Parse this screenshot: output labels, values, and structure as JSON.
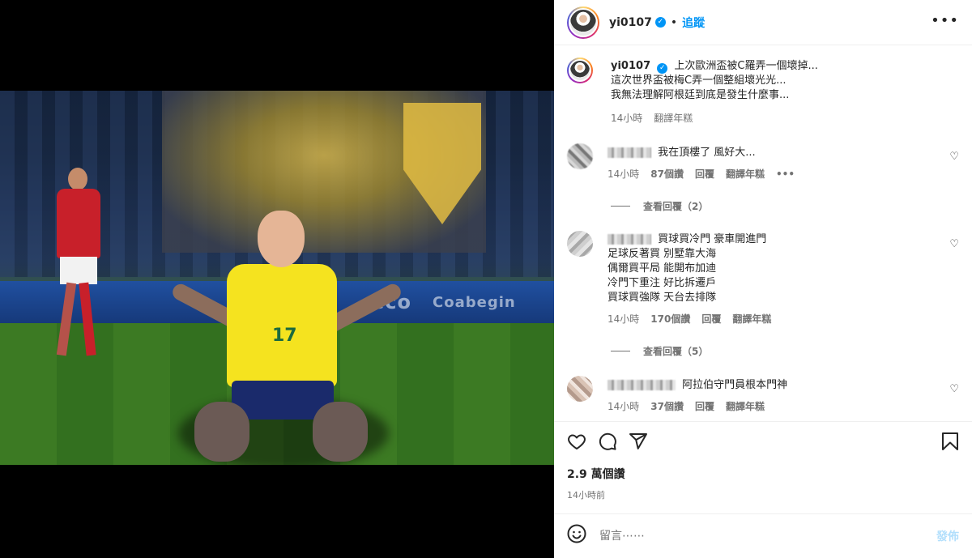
{
  "post": {
    "username": "yi0107",
    "verified_icon": "✓",
    "dot": "•",
    "follow_label": "追蹤",
    "more_icon": "•••"
  },
  "caption": {
    "username": "yi0107",
    "lines": [
      "上次歐洲盃被C羅弄一個壞掉...",
      "這次世界盃被梅C弄一個整組壞光光...",
      "我無法理解阿根廷到底是發生什麼事..."
    ],
    "time": "14小時",
    "translate": "翻譯年糕"
  },
  "comments": [
    {
      "text": "我在頂樓了 風好大...",
      "time": "14小時",
      "likes": "87個讚",
      "reply": "回覆",
      "translate": "翻譯年糕",
      "more": "•••",
      "view_replies": "查看回覆（2）"
    },
    {
      "lines": [
        "買球買冷門 豪車開進門",
        "足球反著買 別墅靠大海",
        "偶爾買平局 能開布加迪",
        "冷門下重注 好比拆遷戶",
        "買球買強隊 天台去排隊"
      ],
      "time": "14小時",
      "likes": "170個讚",
      "reply": "回覆",
      "translate": "翻譯年糕",
      "view_replies": "查看回覆（5）"
    },
    {
      "text": "阿拉伯守門員根本門神",
      "time": "14小時",
      "likes": "37個讚",
      "reply": "回覆",
      "translate": "翻譯年糕"
    }
  ],
  "stats": {
    "likes": "2.9 萬個讚",
    "time": "14小時前"
  },
  "compose": {
    "placeholder": "留言⋯⋯",
    "post_label": "發佈"
  },
  "photo": {
    "jersey_number": "17",
    "ad_text_1": "eco",
    "ad_text_2": "Coabegin"
  },
  "icons": {
    "like": "heart-icon",
    "comment": "comment-icon",
    "share": "share-icon",
    "save": "bookmark-icon",
    "emoji": "emoji-icon"
  }
}
